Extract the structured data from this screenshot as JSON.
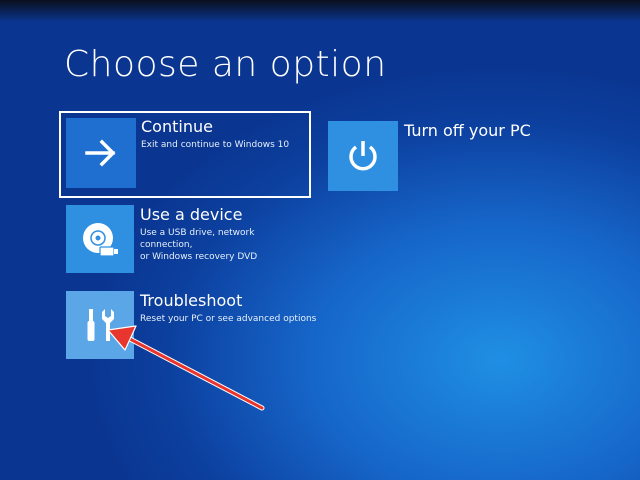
{
  "page": {
    "title": "Choose an option"
  },
  "options": [
    {
      "id": "continue",
      "label": "Continue",
      "description": "Exit and continue to Windows 10",
      "icon": "arrow-right-icon"
    },
    {
      "id": "turn-off",
      "label": "Turn off your PC",
      "description": "",
      "icon": "power-icon"
    },
    {
      "id": "use-device",
      "label": "Use a device",
      "description": "Use a USB drive, network connection,\nor Windows recovery DVD",
      "icon": "disc-drive-icon"
    },
    {
      "id": "troubleshoot",
      "label": "Troubleshoot",
      "description": "Reset your PC or see advanced options",
      "icon": "tools-icon"
    }
  ],
  "annotation": {
    "icon": "red-arrow-icon",
    "color": "#e8352e"
  },
  "colors": {
    "background": "#1666c9",
    "tile": "#2f8fe0",
    "text": "#ffffff"
  }
}
